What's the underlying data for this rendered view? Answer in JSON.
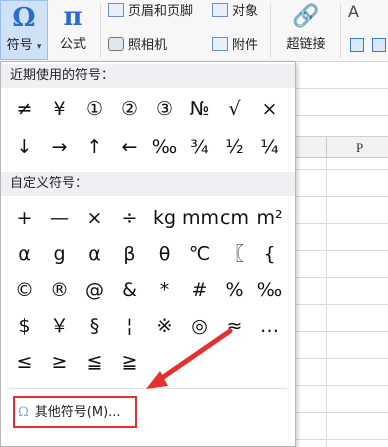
{
  "ribbon": {
    "symbol_icon": "Ω",
    "symbol_label": "符号",
    "symbol_arrow": "▾",
    "formula_icon": "π",
    "formula_label": "公式",
    "header_footer_label": "页眉和页脚",
    "object_label": "对象",
    "camera_label": "照相机",
    "attachment_label": "附件",
    "hyperlink_icon": "🔗",
    "hyperlink_label": "超链接",
    "text_icon": "A"
  },
  "sheet": {
    "column_label": "P"
  },
  "menu": {
    "recent_title": "近期使用的符号：",
    "recent_symbols": [
      "≠",
      "¥",
      "①",
      "②",
      "③",
      "№",
      "√",
      "×",
      "↓",
      "→",
      "↑",
      "←",
      "‰",
      "¾",
      "½",
      "¼"
    ],
    "custom_title": "自定义符号：",
    "custom_symbols": [
      "+",
      "—",
      "×",
      "÷",
      "kg",
      "mm",
      "cm",
      "m²",
      "α",
      "g",
      "α",
      "β",
      "θ",
      "℃",
      "〖",
      "{",
      "©",
      "®",
      "@",
      "&",
      "*",
      "#",
      "%",
      "‰",
      "$",
      "￥",
      "§",
      "¦",
      "※",
      "◎",
      "≈",
      "…",
      "≤",
      "≥",
      "≦",
      "≧"
    ],
    "more_icon": "Ω",
    "more_label": "其他符号(M)..."
  },
  "colors": {
    "accent": "#2a6cc8",
    "highlight_border": "#e53030",
    "selected_button_bg": "#cfe1f7"
  }
}
